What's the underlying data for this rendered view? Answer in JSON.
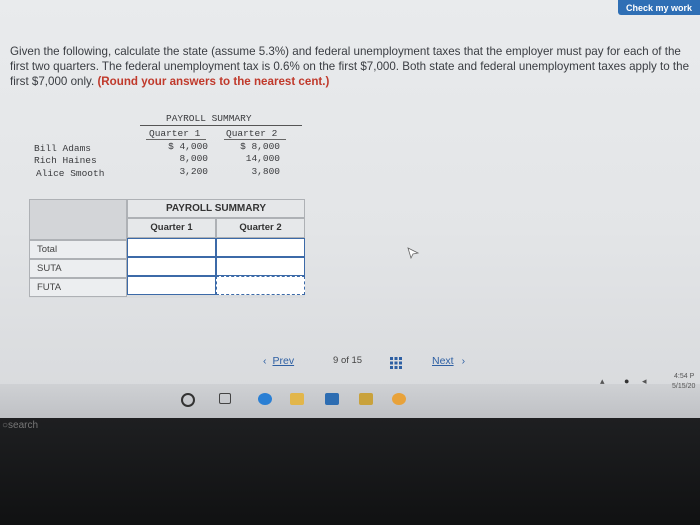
{
  "header": {
    "check_label": "Check my work"
  },
  "question": {
    "text": "Given the following, calculate the state (assume 5.3%) and federal unemployment taxes that the employer must pay for each of the first two quarters. The federal unemployment tax is 0.6% on the first $7,000. Both state and federal unemployment taxes apply to the first $7,000 only. ",
    "emphasis": "(Round your answers to the nearest cent.)"
  },
  "payroll_summary": {
    "title": "PAYROLL SUMMARY",
    "col1": "Quarter 1",
    "col2": "Quarter 2",
    "employees": [
      {
        "name": "Bill Adams",
        "q1": "$ 4,000",
        "q2": "$ 8,000"
      },
      {
        "name": "Rich Haines",
        "q1": "8,000",
        "q2": "14,000"
      },
      {
        "name": "Alice Smooth",
        "q1": "3,200",
        "q2": "3,800"
      }
    ]
  },
  "answer_table": {
    "title": "PAYROLL SUMMARY",
    "col1": "Quarter 1",
    "col2": "Quarter 2",
    "rows": [
      "Total",
      "SUTA",
      "FUTA"
    ],
    "values": [
      [
        "",
        ""
      ],
      [
        "",
        ""
      ],
      [
        "",
        ""
      ]
    ]
  },
  "pager": {
    "prev": "Prev",
    "current": "9",
    "of_label": "of",
    "total": "15",
    "next": "Next"
  },
  "taskbar": {
    "search_label": "search",
    "time": "4:54 P",
    "date": "5/15/20"
  }
}
